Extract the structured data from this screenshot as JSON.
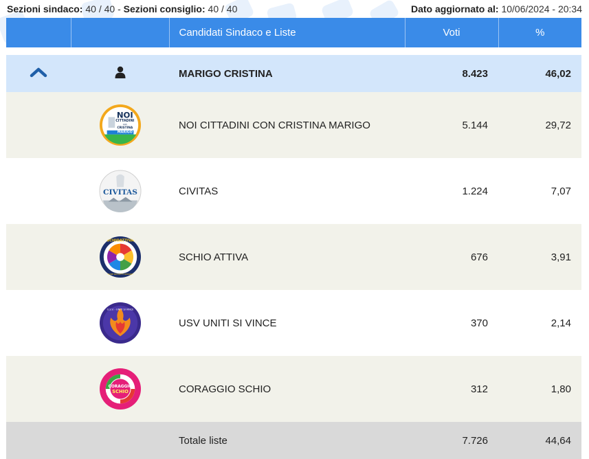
{
  "header": {
    "sezioni_sindaco_label": "Sezioni sindaco:",
    "sezioni_sindaco_value": "40 / 40",
    "separator": "-",
    "sezioni_consiglio_label": "Sezioni consiglio:",
    "sezioni_consiglio_value": "40 / 40",
    "dato_label": "Dato aggiornato al:",
    "dato_value": "10/06/2024 - 20:34"
  },
  "table": {
    "col_name": "Candidati Sindaco e Liste",
    "col_votes": "Voti",
    "col_pct": "%"
  },
  "candidate": {
    "name": "MARIGO CRISTINA",
    "votes": "8.423",
    "pct": "46,02",
    "toggle_icon": "chevron-up-icon",
    "person_icon": "user-icon"
  },
  "lists": [
    {
      "name": "NOI CITTADINI CON CRISTINA MARIGO",
      "votes": "5.144",
      "pct": "29,72",
      "logo_text": [
        "NOI",
        "CITTADINI",
        "con",
        "CRISTINA",
        "MARIGO"
      ]
    },
    {
      "name": "CIVITAS",
      "votes": "1.224",
      "pct": "7,07",
      "logo_text": [
        "CIVITAS"
      ]
    },
    {
      "name": "SCHIO ATTIVA",
      "votes": "676",
      "pct": "3,91",
      "logo_text": [
        "SCHIOATTIVA",
        "PERSONE PROGETTI PROGRESSO"
      ]
    },
    {
      "name": "USV UNITI SI VINCE",
      "votes": "370",
      "pct": "2,14",
      "logo_text": [
        "U.S.V. - UNITI SI VINCE"
      ]
    },
    {
      "name": "CORAGGIO SCHIO",
      "votes": "312",
      "pct": "1,80",
      "logo_text": [
        "CORAGGIO",
        "SCHIO"
      ]
    }
  ],
  "total": {
    "label": "Totale liste",
    "votes": "7.726",
    "pct": "44,64"
  },
  "colors": {
    "header_blue": "#3a8be8",
    "candidate_row": "#d3e6fb",
    "chevron": "#1f5fa8",
    "stripe": "#f2f2ea",
    "total_row": "#d9d9d9"
  }
}
